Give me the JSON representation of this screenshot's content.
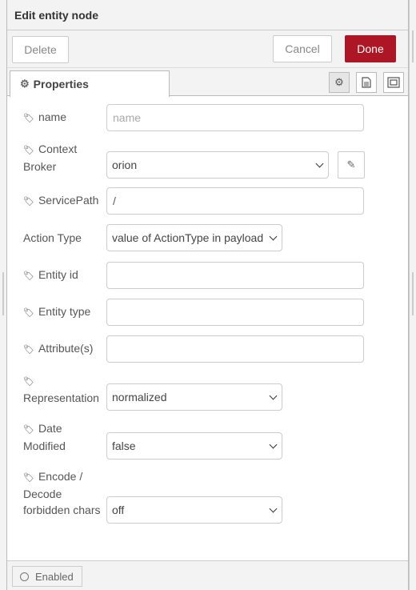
{
  "header": {
    "title": "Edit entity node"
  },
  "toolbar": {
    "delete_label": "Delete",
    "cancel_label": "Cancel",
    "done_label": "Done"
  },
  "tabs": {
    "properties_label": "Properties"
  },
  "form": {
    "name": {
      "label": "name",
      "value": "",
      "placeholder": "name"
    },
    "context_broker": {
      "label": "Context Broker",
      "value": "orion"
    },
    "service_path": {
      "label": "ServicePath",
      "value": "/"
    },
    "action_type": {
      "label": "Action Type",
      "value": "value of ActionType in payload"
    },
    "entity_id": {
      "label": "Entity id",
      "value": ""
    },
    "entity_type": {
      "label": "Entity type",
      "value": ""
    },
    "attributes": {
      "label": "Attribute(s)",
      "value": ""
    },
    "representation": {
      "label": "Representation",
      "value": "normalized"
    },
    "date_modified": {
      "label": "Date Modified",
      "value": "false"
    },
    "encode_decode": {
      "label": "Encode / Decode forbidden chars",
      "value": "off"
    }
  },
  "footer": {
    "enabled_label": "Enabled"
  },
  "colors": {
    "done_bg": "#ad1625",
    "panel_bg": "#f3f3f3"
  },
  "icons": {
    "tag": "tag-icon",
    "gear": "gear-icon",
    "description": "document-icon",
    "appearance": "frame-icon",
    "edit": "pencil-icon",
    "enabled": "circle-icon"
  }
}
